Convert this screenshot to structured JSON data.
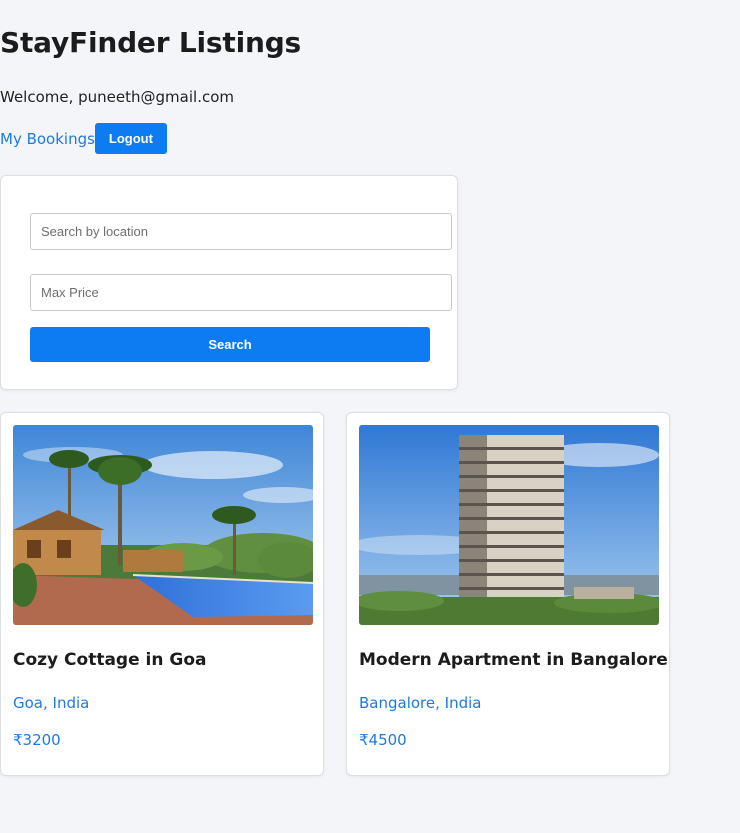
{
  "header": {
    "title": "StayFinder Listings",
    "welcome": "Welcome, puneeth@gmail.com"
  },
  "nav": {
    "bookings_label": "My Bookings",
    "logout_label": "Logout"
  },
  "search": {
    "location_placeholder": "Search by location",
    "location_value": "",
    "price_placeholder": "Max Price",
    "price_value": "",
    "button_label": "Search"
  },
  "listings": [
    {
      "title": "Cozy Cottage in Goa",
      "location": "Goa, India",
      "price": "₹3200",
      "image_icon": "cottage-pool-photo"
    },
    {
      "title": "Modern Apartment in Bangalore",
      "location": "Bangalore, India",
      "price": "₹4500",
      "image_icon": "apartment-tower-photo"
    }
  ],
  "colors": {
    "background": "#f3f5f8",
    "accent": "#0d7cf2",
    "link": "#1f7ae0",
    "card_border": "#dcdfe4"
  }
}
